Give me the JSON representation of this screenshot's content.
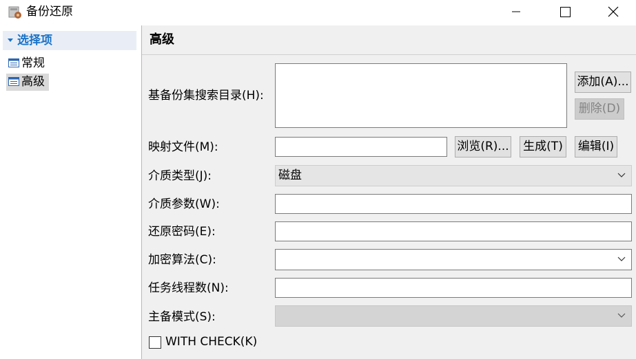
{
  "window": {
    "title": "备份还原",
    "icon": "backup-app-icon",
    "controls": [
      "minimize-icon",
      "maximize-icon",
      "close-icon"
    ]
  },
  "tree": {
    "header": "选择项",
    "items": [
      {
        "label": "常规",
        "icon": "list-icon",
        "selected": false
      },
      {
        "label": "高级",
        "icon": "list-icon",
        "selected": true
      }
    ]
  },
  "panel": {
    "title": "高级",
    "base_search_dir": {
      "label": "基备份集搜索目录(H):",
      "value": ""
    },
    "add_button": "添加(A)...",
    "delete_button": "删除(D)",
    "map_file": {
      "label": "映射文件(M):",
      "value": ""
    },
    "browse_button": "浏览(R)...",
    "generate_button": "生成(T)",
    "edit_button": "编辑(I)",
    "media_type": {
      "label": "介质类型(J):",
      "value": "磁盘"
    },
    "media_params": {
      "label": "介质参数(W):",
      "value": ""
    },
    "restore_password": {
      "label": "还原密码(E):",
      "value": ""
    },
    "encrypt_algo": {
      "label": "加密算法(C):",
      "value": ""
    },
    "task_threads": {
      "label": "任务线程数(N):",
      "value": ""
    },
    "primary_mode": {
      "label": "主备模式(S):",
      "value": ""
    },
    "with_check": {
      "label": "WITH CHECK(K)",
      "checked": false
    }
  }
}
